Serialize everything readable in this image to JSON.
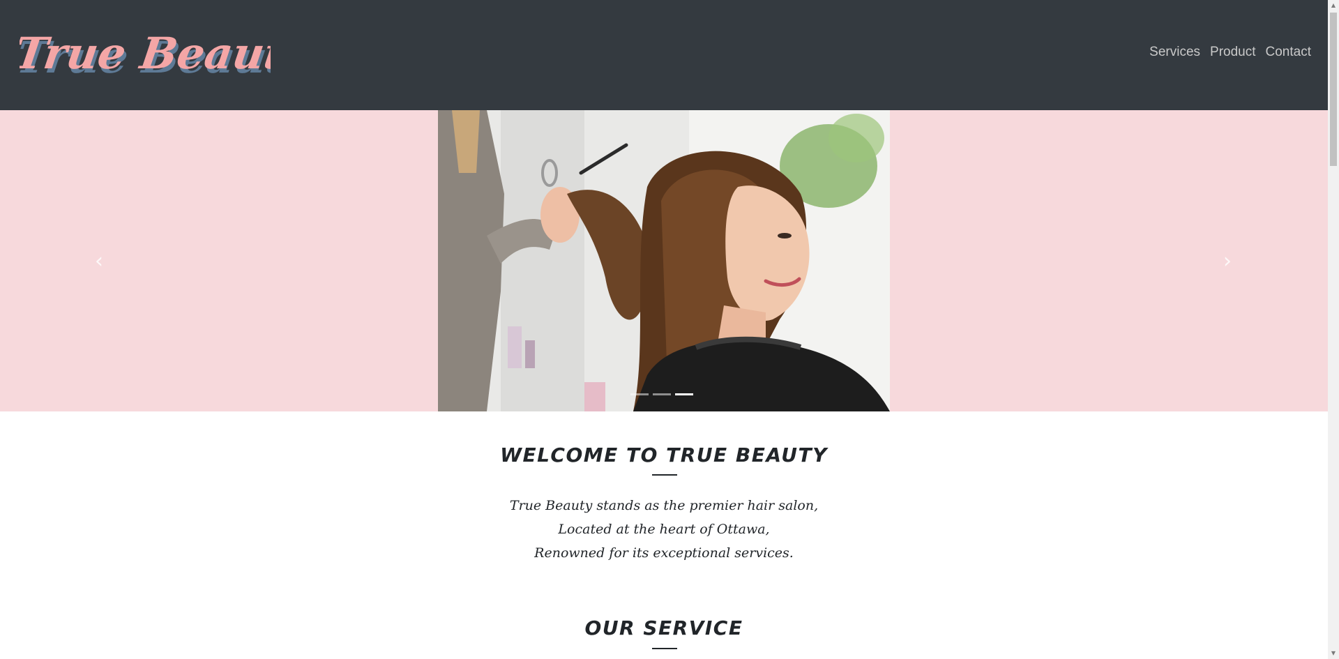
{
  "brand": {
    "logo_text": "True Beauty",
    "logo_fill": "#f4a6a6",
    "logo_shadow": "#5e7a96"
  },
  "nav": {
    "items": [
      {
        "label": "Services"
      },
      {
        "label": "Product"
      },
      {
        "label": "Contact"
      }
    ]
  },
  "carousel": {
    "prev_glyph": "‹",
    "next_glyph": "›",
    "slide_count": 3,
    "active_index": 2,
    "background": "#f7d9dc"
  },
  "welcome": {
    "title": "WELCOME TO TRUE BEAUTY",
    "lines": [
      "True Beauty stands as the premier hair salon,",
      "Located at the heart of Ottawa,",
      "Renowned for its exceptional services."
    ]
  },
  "services": {
    "title": "OUR SERVICE"
  },
  "colors": {
    "navbar": "#343a40",
    "nav_text": "#c9c9c9",
    "heading": "#212529"
  }
}
